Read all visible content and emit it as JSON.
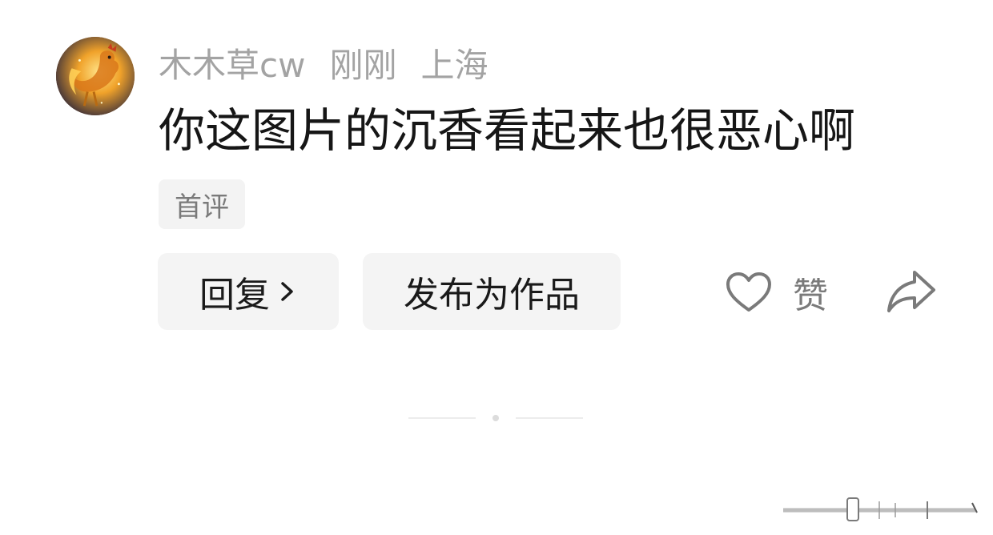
{
  "comment": {
    "username": "木木草cw",
    "time": "刚刚",
    "location": "上海",
    "text": "你这图片的沉香看起来也很恶心啊",
    "tag": "首评"
  },
  "actions": {
    "reply_label": "回复",
    "publish_label": "发布为作品",
    "like_label": "赞"
  },
  "icons": {
    "avatar": "golden-rooster-avatar",
    "reply_chevron": "chevron-right-icon",
    "like": "heart-outline-icon",
    "share": "share-arrow-icon"
  },
  "colors": {
    "meta_text": "#a3a3a3",
    "comment_text": "#161616",
    "button_bg": "#f4f4f4",
    "icon_gray": "#7a7a7a"
  }
}
